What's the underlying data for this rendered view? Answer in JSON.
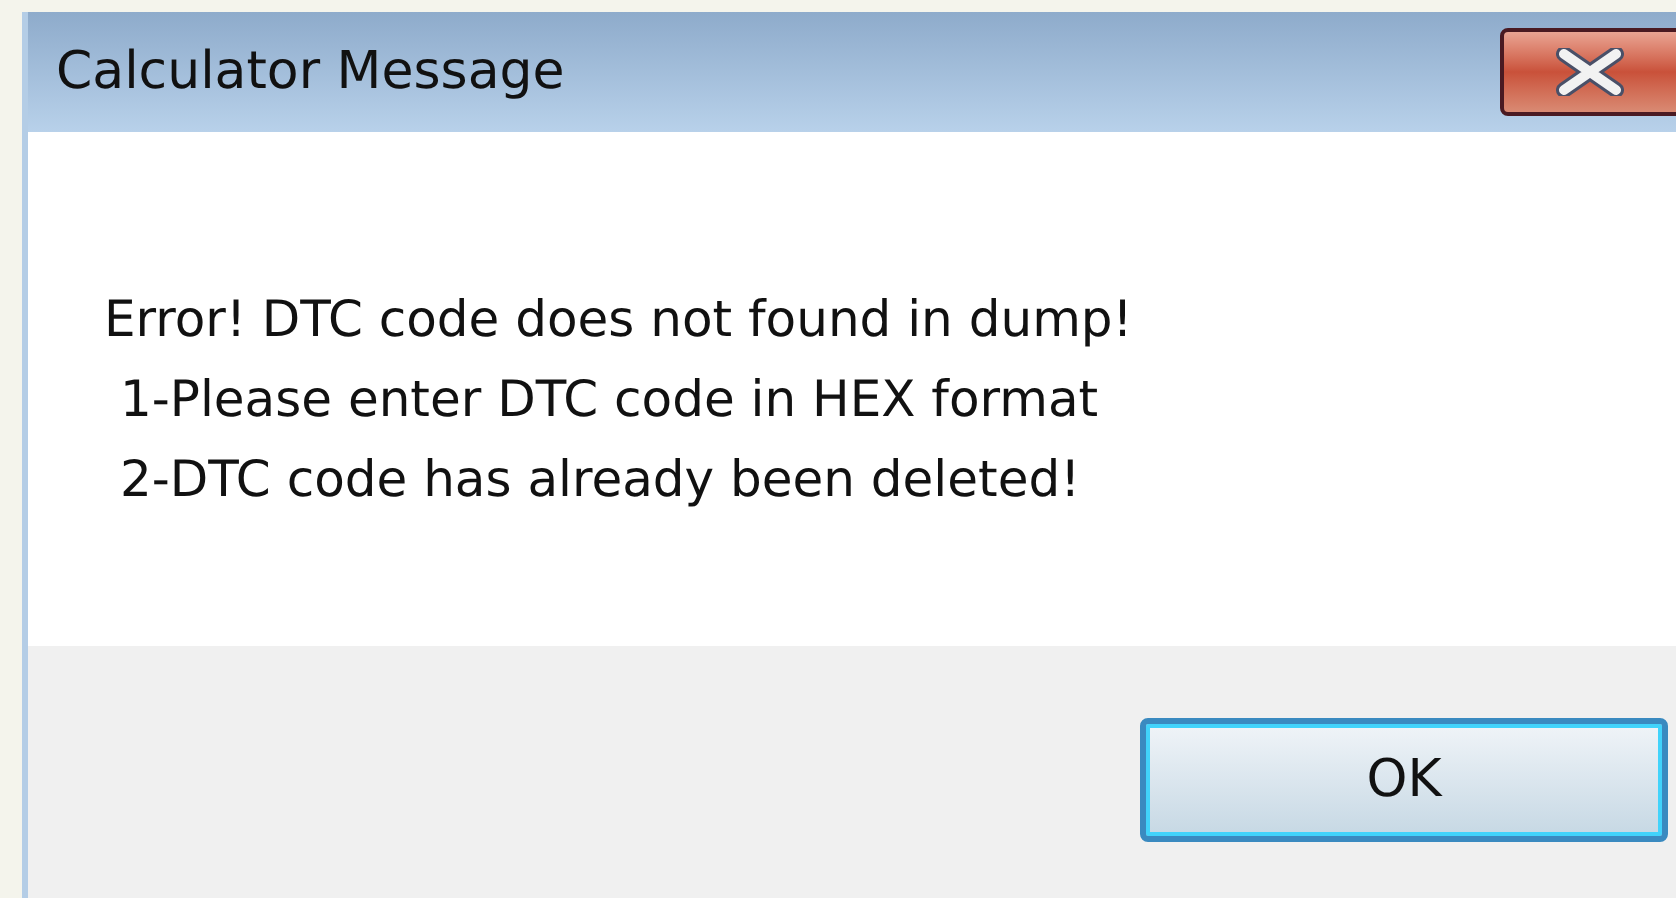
{
  "window": {
    "title": "Calculator Message"
  },
  "message": {
    "lines": [
      "Error! DTC code does not found in dump!",
      "1-Please enter DTC code in HEX format",
      "2-DTC code has already been deleted!"
    ]
  },
  "buttons": [
    {
      "label": "OK",
      "focused": true
    }
  ]
}
